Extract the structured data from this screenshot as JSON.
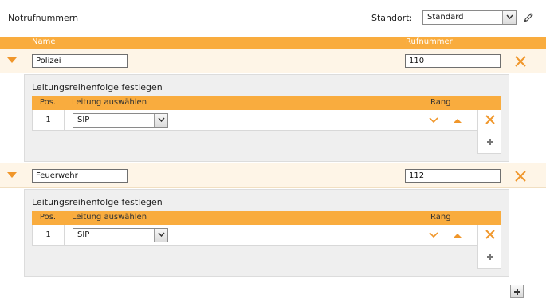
{
  "page": {
    "title": "Notrufnummern"
  },
  "location": {
    "label": "Standort:",
    "selected": "Standard"
  },
  "table_header": {
    "name": "Name",
    "number": "Rufnummer"
  },
  "entries": [
    {
      "name": "Polizei",
      "number": "110",
      "lines_caption": "Leitungsreihenfolge festlegen",
      "columns": {
        "pos": "Pos.",
        "line": "Leitung auswählen",
        "rank": "Rang"
      },
      "lines": [
        {
          "pos": "1",
          "line": "SIP"
        }
      ]
    },
    {
      "name": "Feuerwehr",
      "number": "112",
      "lines_caption": "Leitungsreihenfolge festlegen",
      "columns": {
        "pos": "Pos.",
        "line": "Leitung auswählen",
        "rank": "Rang"
      },
      "lines": [
        {
          "pos": "1",
          "line": "SIP"
        }
      ]
    }
  ],
  "icons": {
    "expand": "chevron-down-icon",
    "delete": "close-icon",
    "edit": "pencil-icon",
    "add": "plus-icon",
    "rank_down": "arrow-down-icon",
    "rank_up": "arrow-up-icon"
  },
  "colors": {
    "accent": "#f9ac3e",
    "row_background": "#fef5e7",
    "panel_background": "#efefef",
    "icon_orange": "#f0962a"
  }
}
